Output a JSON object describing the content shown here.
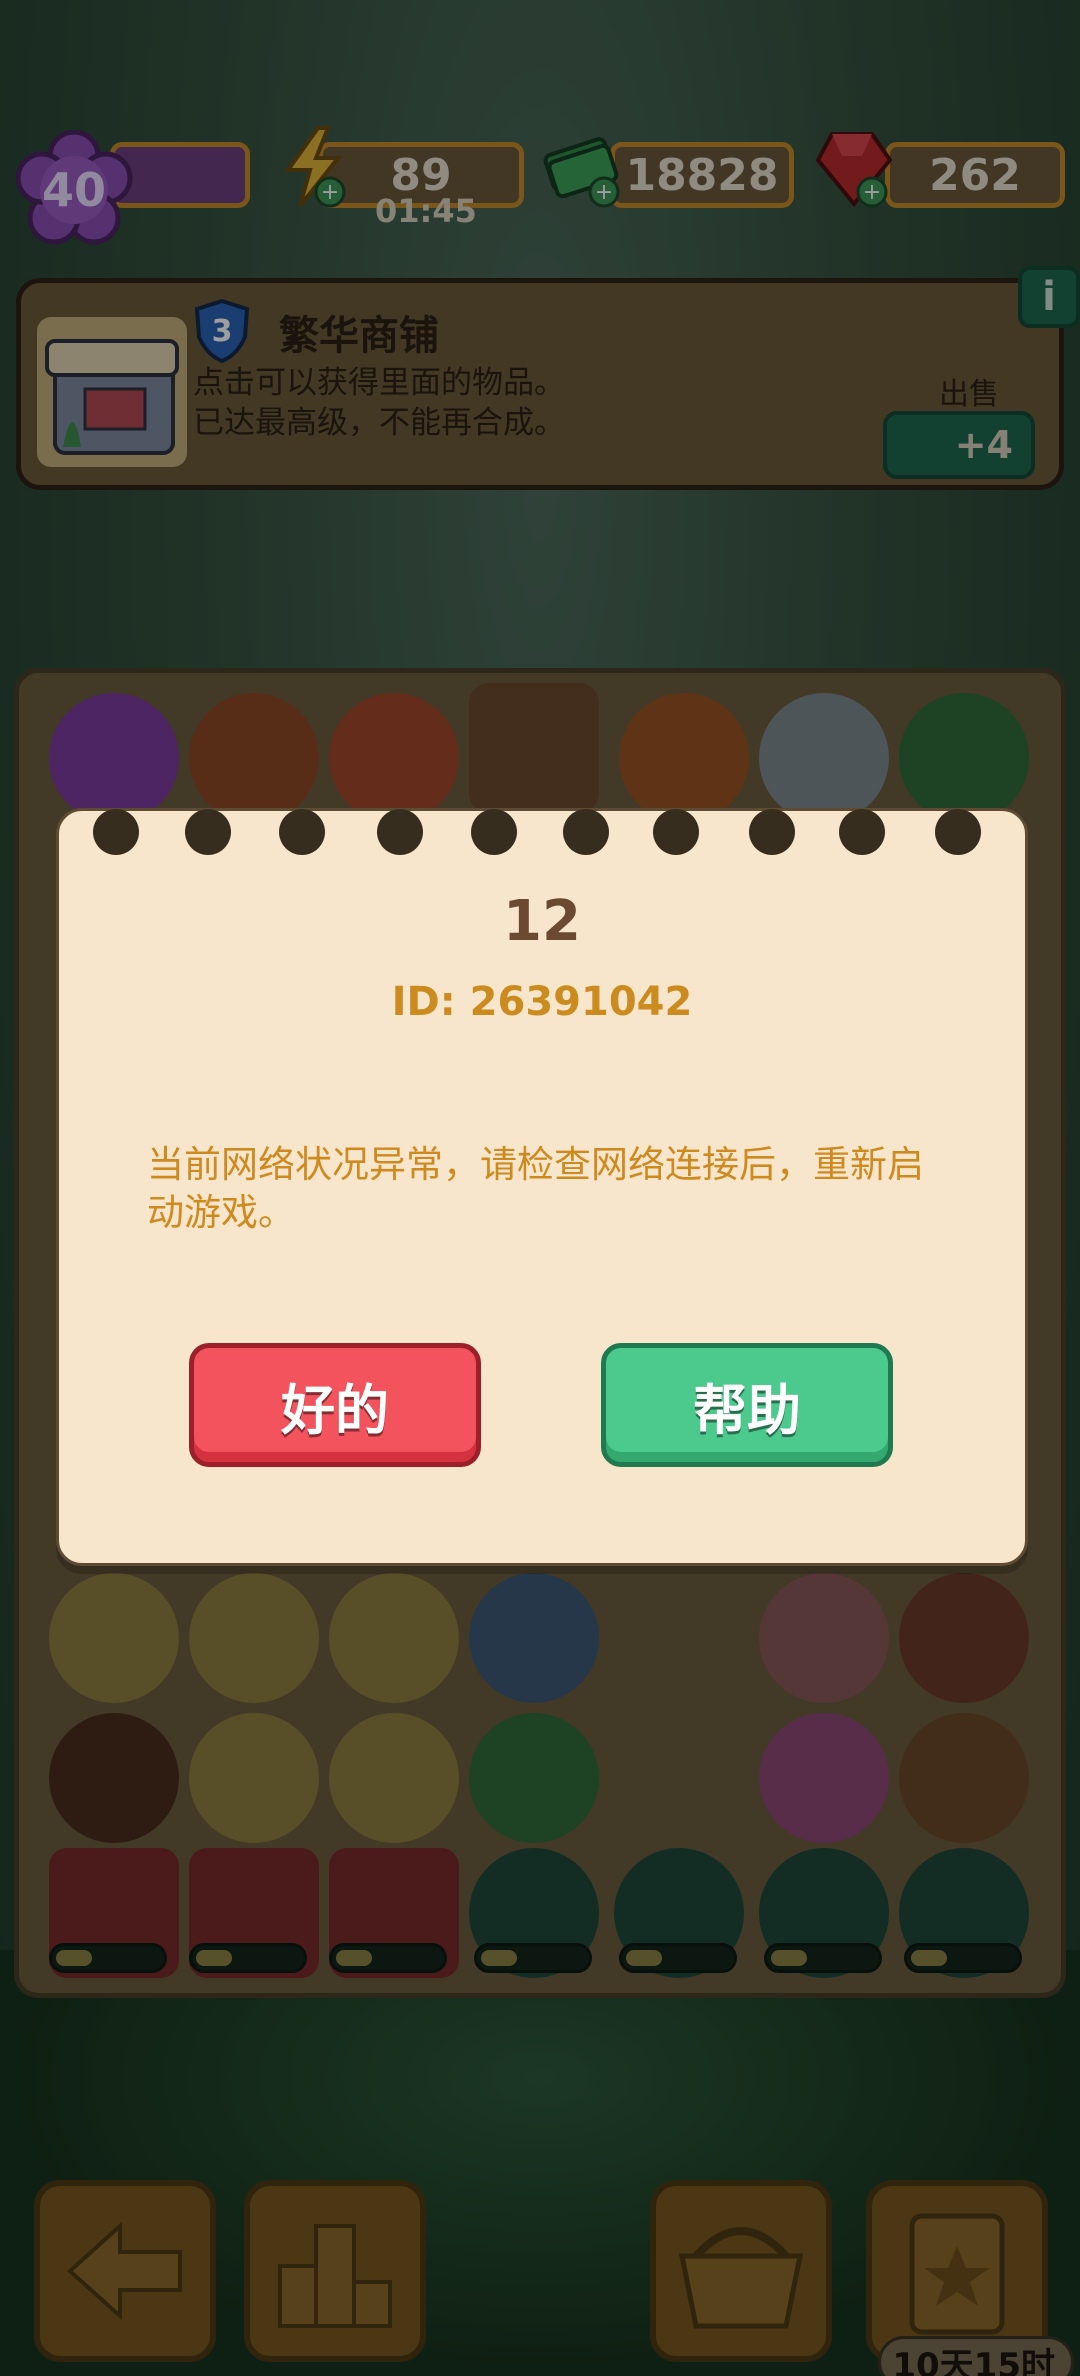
{
  "topbar": {
    "level": "40",
    "energy": "89",
    "energy_timer": "01:45",
    "cash": "18828",
    "gems": "262"
  },
  "info_panel": {
    "shield_level": "3",
    "shop_name": "繁华商铺",
    "desc_line1": "点击可以获得里面的物品。",
    "desc_line2": "已达最高级，不能再合成。",
    "sell_label": "出售",
    "sell_value": "+4",
    "info_label": "i"
  },
  "dialog": {
    "code": "12",
    "id_text": "ID: 26391042",
    "message": "当前网络状况异常，请检查网络连接后，重新启动游戏。",
    "ok_label": "好的",
    "help_label": "帮助"
  },
  "event_timer": "10天15时",
  "colors": {
    "ok_button": "#f2535c",
    "help_button": "#4cc98c",
    "dialog_bg": "#f7e6cc",
    "message_text": "#cf8a1f"
  }
}
